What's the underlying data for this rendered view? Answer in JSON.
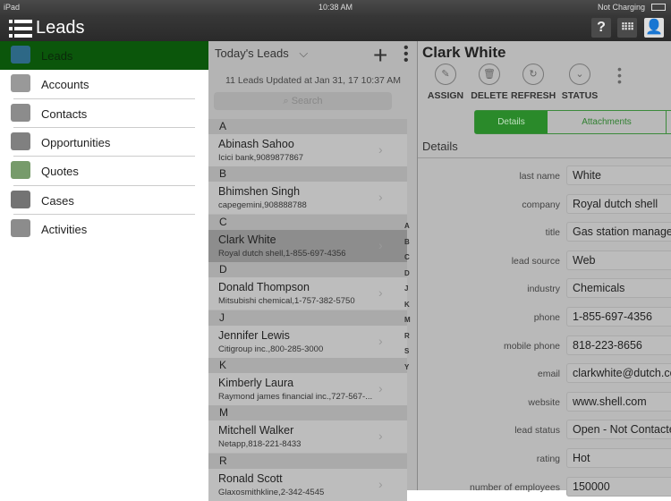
{
  "status_bar": {
    "device": "iPad",
    "time": "10:38 AM",
    "battery": "Not Charging"
  },
  "header": {
    "title": "Leads",
    "help": "?"
  },
  "sidebar": {
    "items": [
      {
        "label": "Leads",
        "icon": "leads-icon"
      },
      {
        "label": "Accounts",
        "icon": "folder-icon"
      },
      {
        "label": "Contacts",
        "icon": "contact-card-icon"
      },
      {
        "label": "Opportunities",
        "icon": "opportunities-icon"
      },
      {
        "label": "Quotes",
        "icon": "quotes-icon"
      },
      {
        "label": "Cases",
        "icon": "cases-icon"
      },
      {
        "label": "Activities",
        "icon": "activities-icon"
      }
    ]
  },
  "list": {
    "title": "Today's Leads",
    "updated": "11 Leads Updated at Jan 31, 17 10:37 AM",
    "search_placeholder": "Search",
    "sections": [
      {
        "letter": "A",
        "name": "Abinash Sahoo",
        "sub": "Icici bank,9089877867"
      },
      {
        "letter": "B",
        "name": "Bhimshen Singh",
        "sub": "capegemini,908888788"
      },
      {
        "letter": "C",
        "name": "Clark White",
        "sub": "Royal dutch shell,1-855-697-4356",
        "selected": true
      },
      {
        "letter": "D",
        "name": "Donald Thompson",
        "sub": "Mitsubishi chemical,1-757-382-5750"
      },
      {
        "letter": "J",
        "name": "Jennifer Lewis",
        "sub": "Citigroup inc.,800-285-3000"
      },
      {
        "letter": "K",
        "name": "Kimberly Laura",
        "sub": "Raymond james financial inc.,727-567-..."
      },
      {
        "letter": "M",
        "name": "Mitchell Walker",
        "sub": "Netapp,818-221-8433"
      },
      {
        "letter": "R",
        "name": "Ronald Scott",
        "sub": "Glaxosmithkline,2-342-4545"
      }
    ],
    "index": [
      "A",
      "B",
      "C",
      "D",
      "J",
      "K",
      "M",
      "R",
      "S",
      "Y"
    ]
  },
  "detail": {
    "title": "Clark White",
    "actions": [
      {
        "label": "ASSIGN",
        "icon": "✎"
      },
      {
        "label": "DELETE",
        "icon": "🗑"
      },
      {
        "label": "REFRESH",
        "icon": "↻"
      },
      {
        "label": "STATUS",
        "icon": "⌄"
      }
    ],
    "tabs": [
      "Details",
      "Attachments"
    ],
    "section": "Details",
    "fields": [
      [
        "last name",
        "White"
      ],
      [
        "company",
        "Royal dutch shell"
      ],
      [
        "title",
        "Gas station manager"
      ],
      [
        "lead source",
        "Web"
      ],
      [
        "industry",
        "Chemicals"
      ],
      [
        "phone",
        "1-855-697-4356"
      ],
      [
        "mobile phone",
        "818-223-8656"
      ],
      [
        "email",
        "clarkwhite@dutch.com"
      ],
      [
        "website",
        "www.shell.com"
      ],
      [
        "lead status",
        "Open - Not Contacted"
      ],
      [
        "rating",
        "Hot"
      ],
      [
        "number of employees",
        "150000"
      ]
    ]
  }
}
